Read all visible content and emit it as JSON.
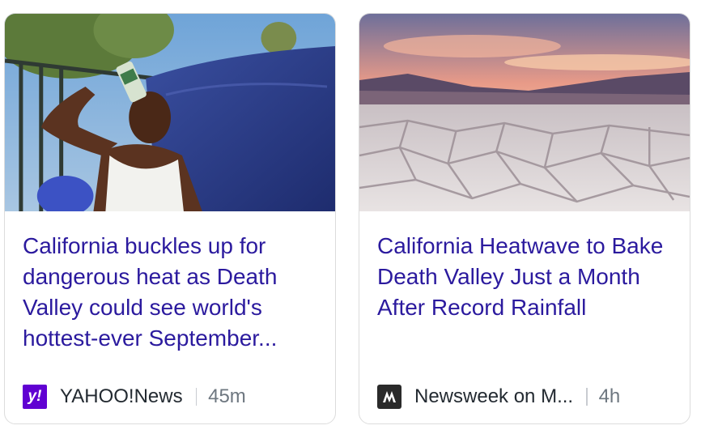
{
  "cards": [
    {
      "headline": "California buckles up for dangerous heat as Death Valley could see world's hottest-ever September...",
      "source": "YAHOO!News",
      "source_logo_text": "y!",
      "time": "45m",
      "image_icon": "man-drinking-in-heat-photo"
    },
    {
      "headline": "California Heatwave to Bake Death Valley Just a Month After Record Rainfall",
      "source": "Newsweek on M...",
      "time": "4h",
      "image_icon": "cracked-desert-floor-photo"
    }
  ],
  "colors": {
    "headline": "#2b1a9e",
    "yahoo_purple": "#6001d2",
    "time_gray": "#6e7780"
  }
}
